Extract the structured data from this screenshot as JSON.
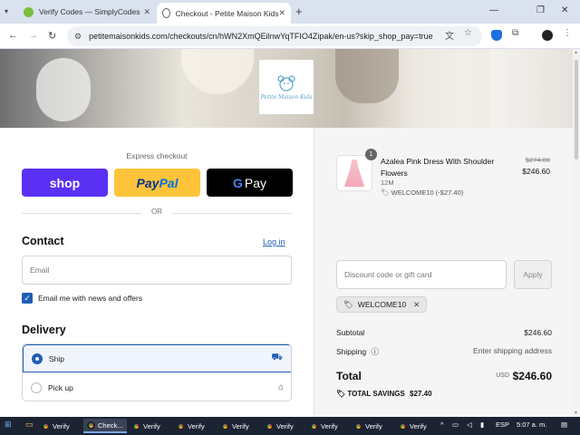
{
  "browser": {
    "tabs": [
      {
        "title": "Verify Codes — SimplyCodes",
        "active": false,
        "favicon_color": "#7bbf3a"
      },
      {
        "title": "Checkout - Petite Maison Kids",
        "active": true,
        "favicon_color": "#8a8f99"
      }
    ],
    "url": "petitemaisonkids.com/checkouts/cn/hWN2XmQEilnwYqTFIO4Zipak/en-us?skip_shop_pay=true"
  },
  "brand": {
    "logo_text": "Petite Maison Kids",
    "accent": "#1f5fb5"
  },
  "express": {
    "label": "Express checkout",
    "shop": "shop",
    "paypal_a": "Pay",
    "paypal_b": "Pal",
    "gpay_g": "G",
    "gpay_text": "Pay",
    "or": "OR"
  },
  "contact": {
    "heading": "Contact",
    "login": "Log in",
    "email_placeholder": "Email",
    "newsletter": "Email me with news and offers"
  },
  "delivery": {
    "heading": "Delivery",
    "options": [
      {
        "label": "Ship",
        "selected": true,
        "icon": "truck-icon"
      },
      {
        "label": "Pick up",
        "selected": false,
        "icon": "store-icon"
      }
    ]
  },
  "cart": {
    "item": {
      "quantity": "1",
      "name": "Azalea Pink Dress With Shoulder Flowers",
      "variant": "12M",
      "discount": "WELCOME10 (-$27.40)",
      "original_price": "$274.00",
      "price": "$246.60"
    },
    "discount_placeholder": "Discount code or gift card",
    "apply": "Apply",
    "applied_code": "WELCOME10",
    "subtotal_label": "Subtotal",
    "subtotal": "$246.60",
    "shipping_label": "Shipping",
    "shipping": "Enter shipping address",
    "total_label": "Total",
    "currency": "USD",
    "total": "$246.60",
    "savings_label": "TOTAL SAVINGS",
    "savings": "$27.40"
  },
  "taskbar": {
    "items": [
      "Verify",
      "Check...",
      "Verify",
      "Verify",
      "Verify",
      "Verify",
      "Verify",
      "Verify",
      "Verify"
    ],
    "language": "ESP",
    "time": "5:07 a. m."
  }
}
